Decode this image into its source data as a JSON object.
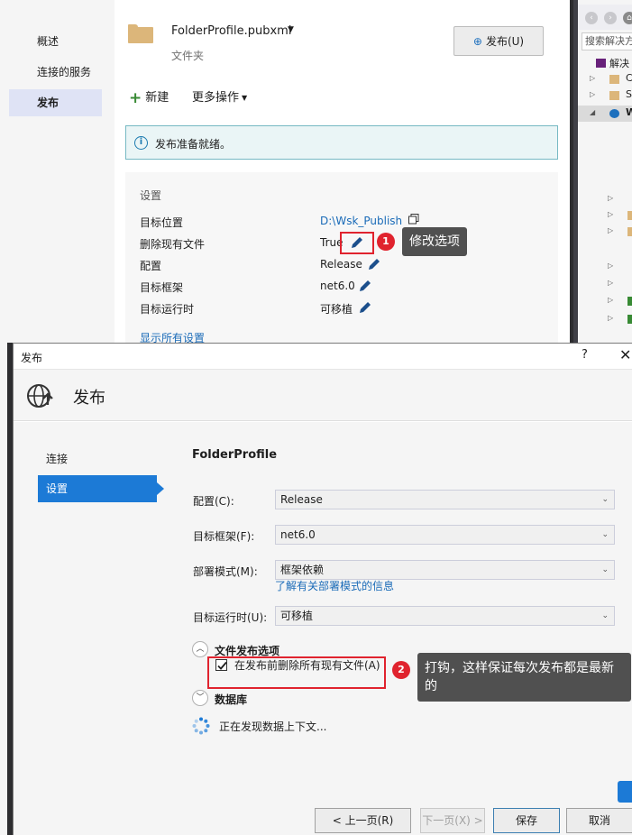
{
  "publish_page": {
    "nav": [
      "概述",
      "连接的服务",
      "发布"
    ],
    "profile_name": "FolderProfile.pubxml",
    "profile_type": "文件夹",
    "publish_button": "发布(U)",
    "new_label": "新建",
    "more_label": "更多操作",
    "ready_text": "发布准备就绪。",
    "settings_title": "设置",
    "settings": [
      {
        "label": "目标位置",
        "value": "D:\\Wsk_Publish"
      },
      {
        "label": "删除现有文件",
        "value": "True"
      },
      {
        "label": "配置",
        "value": "Release"
      },
      {
        "label": "目标框架",
        "value": "net6.0"
      },
      {
        "label": "目标运行时",
        "value": "可移植"
      }
    ],
    "show_all": "显示所有设置"
  },
  "annotations": {
    "badge1": "1",
    "callout1": "修改选项",
    "badge2": "2",
    "callout2": "打钩，这样保证每次发布都是最新的"
  },
  "solution_explorer": {
    "search_placeholder": "搜索解决方",
    "rows": [
      "解决",
      "C",
      "S",
      "W"
    ]
  },
  "dialog": {
    "window_title": "发布",
    "help": "?",
    "header_title": "发布",
    "steps": [
      "连接",
      "设置"
    ],
    "profile_heading": "FolderProfile",
    "fields": [
      {
        "label": "配置(C):",
        "value": "Release"
      },
      {
        "label": "目标框架(F):",
        "value": "net6.0"
      },
      {
        "label": "部署模式(M):",
        "value": "框架依赖"
      },
      {
        "label": "目标运行时(U):",
        "value": "可移植"
      }
    ],
    "learn_link": "了解有关部署模式的信息",
    "section_publish_options": "文件发布选项",
    "delete_checkbox_label": "在发布前删除所有现有文件(A)",
    "delete_checked": true,
    "section_database": "数据库",
    "discovering": "正在发现数据上下文...",
    "buttons": {
      "prev": "< 上一页(R)",
      "next": "下一页(X) >",
      "save": "保存",
      "cancel": "取消"
    }
  }
}
